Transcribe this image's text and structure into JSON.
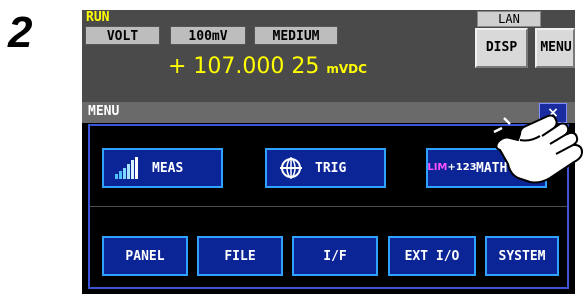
{
  "step_number": "2",
  "status": {
    "run": "RUN",
    "lan": "LAN"
  },
  "settings": [
    "VOLT",
    "100mV",
    "MEDIUM"
  ],
  "top_buttons": {
    "disp": "DISP",
    "menu": "MENU"
  },
  "reading": {
    "value": "+ 107.000 25",
    "unit": "mVDC"
  },
  "menu": {
    "title": "MENU",
    "close": "×",
    "main_items": [
      {
        "label": "MEAS",
        "icon": "bar-level-icon"
      },
      {
        "label": "TRIG",
        "icon": "crosshair-globe-icon"
      },
      {
        "label": "MATH",
        "icon": "lim-123-icon",
        "icon_text_top": "LIM",
        "icon_text_bottom": "+123"
      }
    ],
    "sub_items": [
      "PANEL",
      "FILE",
      "I/F",
      "EXT I/O",
      "SYSTEM"
    ]
  },
  "colors": {
    "button_fill": "#0b2596",
    "button_border": "#2fa2ff",
    "reading": "#ffff00",
    "panel_border": "#3b55d8"
  }
}
